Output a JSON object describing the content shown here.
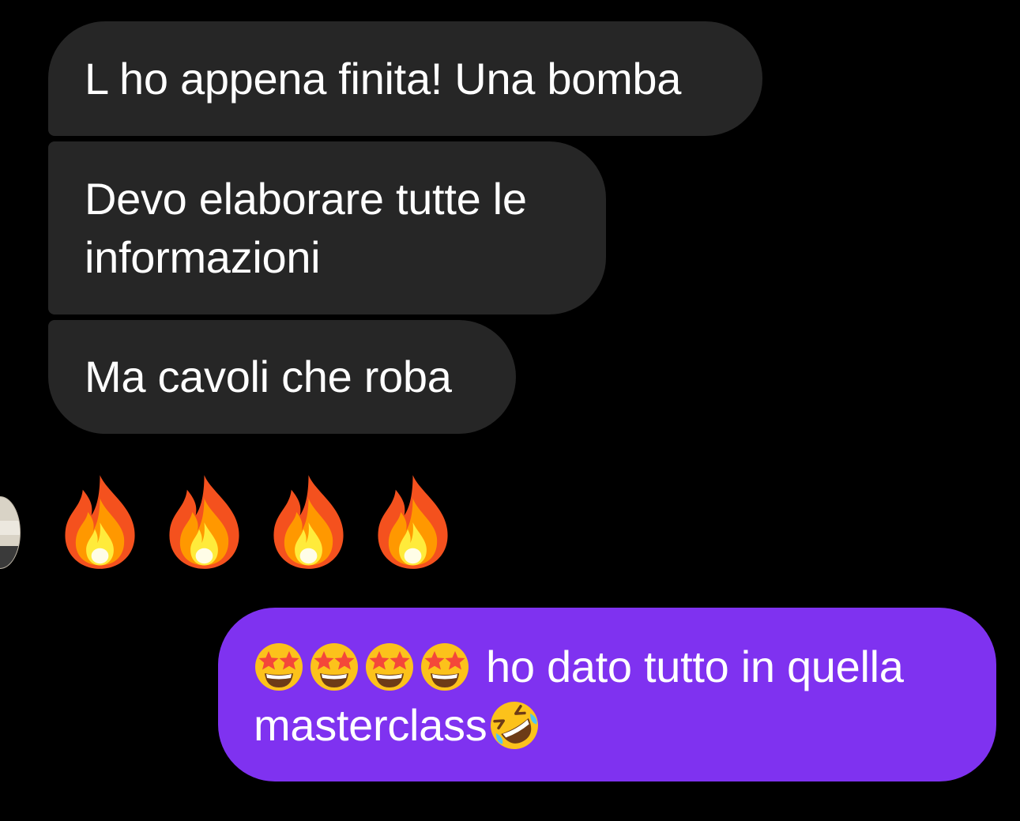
{
  "chat": {
    "incoming": [
      {
        "text": "L ho appena finita! Una bomba"
      },
      {
        "text_line1": "Devo elaborare tutte le",
        "text_line2": "informazioni"
      },
      {
        "text": "Ma cavoli che roba"
      }
    ],
    "emoji_message": {
      "icons": [
        "fire-icon",
        "fire-icon",
        "fire-icon",
        "fire-icon"
      ]
    },
    "outgoing": {
      "leading_icons": [
        "star-struck-icon",
        "star-struck-icon",
        "star-struck-icon",
        "star-struck-icon"
      ],
      "text_line1": "ho dato tutto in quella",
      "text_line2": "masterclass",
      "trailing_icon": "rofl-icon"
    }
  },
  "colors": {
    "background": "#000000",
    "incoming_bubble": "#262626",
    "outgoing_bubble": "#7f32f0",
    "text": "#ffffff"
  }
}
